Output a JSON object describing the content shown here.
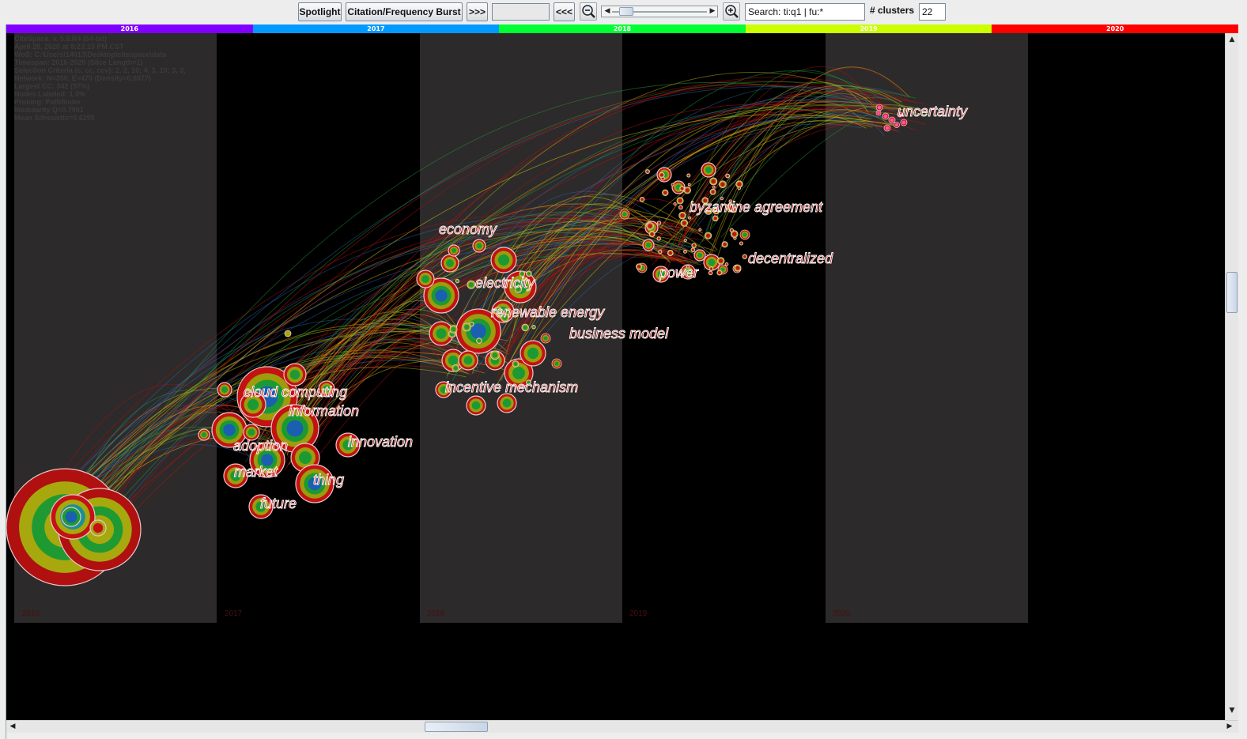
{
  "toolbar": {
    "spotlight_label": "Spotlight",
    "burst_label": "Citation/Frequency Burst",
    "next_label": ">>>",
    "prev_label": "<<<",
    "search_value": "Search: ti:q1 | fu:*",
    "clusters_label": "# clusters",
    "clusters_value": "22"
  },
  "timeline": {
    "slices": [
      {
        "year": "2016",
        "color": "#8000ff"
      },
      {
        "year": "2017",
        "color": "#0099ff"
      },
      {
        "year": "2018",
        "color": "#00ff33"
      },
      {
        "year": "2019",
        "color": "#ccff00"
      },
      {
        "year": "2020",
        "color": "#ff0000"
      }
    ]
  },
  "info": {
    "lines": [
      "CiteSpace, v. 5.6.R4 (64-bit)",
      "April 28, 2020 at 8:23:10 PM CST",
      "WoS: C:\\Users\\14013\\Desktop\\citespace\\data",
      "Timespan: 2016-2020 (Slice Length=1)",
      "Selection Criteria (c, cc, ccv): 2, 2, 10; 4, 3, 10; 3, 3,",
      "Network: N=350, E=470 (Density=0.0077)",
      "Largest CC: 342 (97%)",
      "Nodes Labeled: 1.0%",
      "Pruning: Pathfinder",
      "Modularity Q=0.7901",
      "Mean Silhouette=0.6295"
    ]
  },
  "network": {
    "column_years": [
      "2016",
      "2017",
      "2018",
      "2019",
      "2020"
    ],
    "labels": [
      "uncertainty",
      "byzantine agreement",
      "decentralized",
      "power",
      "economy",
      "electricity",
      "renewable energy",
      "business model",
      "incentive mechanism",
      "cloud computing",
      "information",
      "adoption",
      "innovation",
      "market",
      "thing",
      "future"
    ]
  }
}
